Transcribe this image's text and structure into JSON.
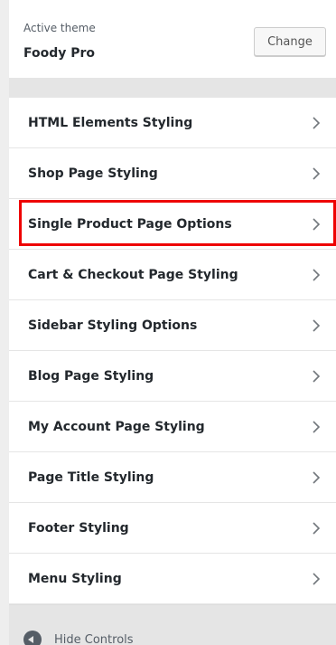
{
  "theme": {
    "active_label": "Active theme",
    "name": "Foody Pro",
    "change_label": "Change"
  },
  "menu": {
    "items": [
      {
        "label": "HTML Elements Styling"
      },
      {
        "label": "Shop Page Styling"
      },
      {
        "label": "Single Product Page Options"
      },
      {
        "label": "Cart & Checkout Page Styling"
      },
      {
        "label": "Sidebar Styling Options"
      },
      {
        "label": "Blog Page Styling"
      },
      {
        "label": "My Account Page Styling"
      },
      {
        "label": "Page Title Styling"
      },
      {
        "label": "Footer Styling"
      },
      {
        "label": "Menu Styling"
      }
    ],
    "highlighted_index": 2,
    "highlight_color": "#ee0000"
  },
  "footer": {
    "hide_controls_label": "Hide Controls",
    "hide_controls_icon": "collapse-arrow-icon"
  }
}
